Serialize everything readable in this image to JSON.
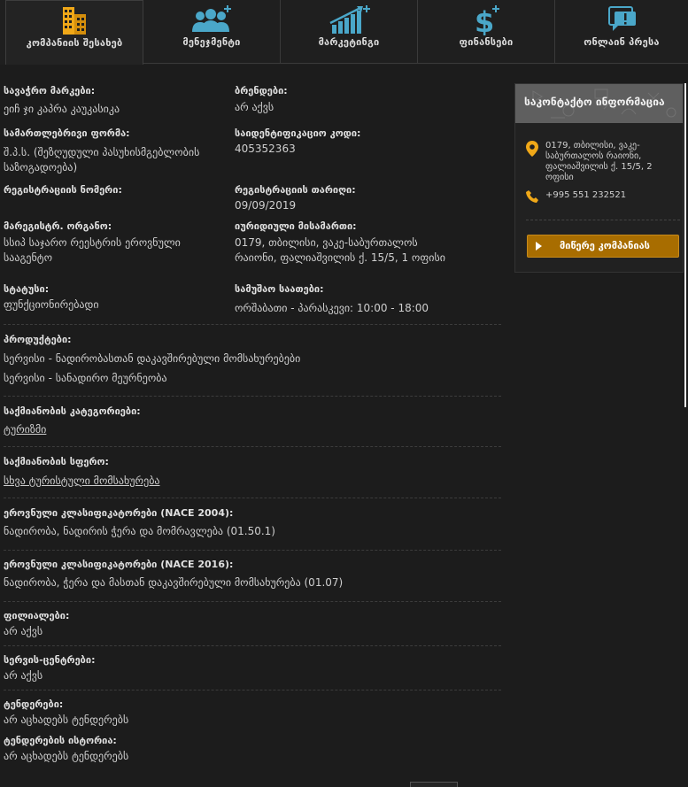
{
  "tabs": [
    {
      "label": "კომპანიის შესახებ",
      "icon": "building-icon"
    },
    {
      "label": "მენეჯმენტი",
      "icon": "users-plus-icon"
    },
    {
      "label": "მარკეტინგი",
      "icon": "growth-chart-icon"
    },
    {
      "label": "ფინანსები",
      "icon": "dollar-plus-icon"
    },
    {
      "label": "ონლაინ პრესა",
      "icon": "chat-alert-icon"
    }
  ],
  "fields": {
    "brand_name": {
      "label": "სავაჭრო მარკები:",
      "value": "ეიჩ ჯი კაპრა კაუკასიკა"
    },
    "brands": {
      "label": "ბრენდები:",
      "value": "არ აქვს"
    },
    "legal_form": {
      "label": "სამართლებრივი ფორმა:",
      "value": "შ.პ.ს. (შეზღუდული პასუხისმგებლობის საზოგადოება)"
    },
    "id_code": {
      "label": "საიდენტიფიკაციო კოდი:",
      "value": "405352363"
    },
    "reg_number": {
      "label": "რეგისტრაციის ნომერი:",
      "value": ""
    },
    "reg_date": {
      "label": "რეგისტრაციის თარიღი:",
      "value": "09/09/2019"
    },
    "registrar": {
      "label": "მარეგისტრ. ორგანო:",
      "value": "სსიპ საჯარო რეესტრის ეროვნული სააგენტო"
    },
    "legal_address": {
      "label": "იურიდიული მისამართი:",
      "value": "0179, თბილისი, ვაკე-საბურთალოს რაიონი, ფალიაშვილის ქ. 15/5, 1 ოფისი"
    },
    "status": {
      "label": "სტატუსი:",
      "value": "ფუნქციონირებადი"
    },
    "hours": {
      "label": "სამუშაო საათები:",
      "value": "ორშაბათი - პარასკევი: 10:00 - 18:00"
    }
  },
  "products": {
    "label": "პროდუქტები:",
    "items": [
      "სერვისი - ნადირობასთან დაკავშირებული მომსახურებები",
      "სერვისი - სანადირო მეურნეობა"
    ]
  },
  "category": {
    "label": "საქმიანობის კატეგორიები:",
    "value": "ტურიზმი"
  },
  "sphere": {
    "label": "საქმიანობის სფერო:",
    "value": "სხვა ტურისტული მომსახურება"
  },
  "nace2004": {
    "label": "ეროვნული კლასიფიკატორები (NACE 2004):",
    "value": "ნადირობა, ნადირის ჭერა და მომრავლება (01.50.1)"
  },
  "nace2016": {
    "label": "ეროვნული კლასიფიკატორები (NACE 2016):",
    "value": "ნადირობა, ჭერა და მასთან დაკავშირებული მომსახურება (01.07)"
  },
  "branches": {
    "label": "ფილიალები:",
    "value": "არ აქვს"
  },
  "service_centers": {
    "label": "სერვის-ცენტრები:",
    "value": "არ აქვს"
  },
  "tenders": {
    "label": "ტენდერები:",
    "value": "არ აცხადებს ტენდერებს"
  },
  "tender_history": {
    "label": "ტენდერების ისტორია:",
    "value": "არ აცხადებს ტენდერებს"
  },
  "contact": {
    "title": "საკონტაქტო ინფორმაცია",
    "address": "0179, თბილისი, ვაკე-საბურთალოს რაიონი, ფალიაშვილის ქ. 15/5, 2 ოფისი",
    "phone": "+995 551 232521",
    "button_label": "მიწერე კომპანიას",
    "icon_address": "location-pin-icon",
    "icon_phone": "phone-icon"
  },
  "colors": {
    "accent": "#f0a818",
    "button": "#a86d00",
    "tab_icon": "#4aa7c9",
    "background": "#1c1c1c"
  }
}
